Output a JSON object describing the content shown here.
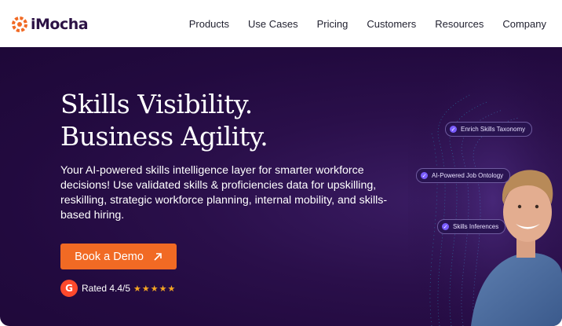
{
  "header": {
    "logo_text": "iMocha",
    "nav": [
      "Products",
      "Use Cases",
      "Pricing",
      "Customers",
      "Resources",
      "Company"
    ]
  },
  "hero": {
    "headline_line1": "Skills Visibility.",
    "headline_line2": "Business Agility.",
    "description": "Your AI-powered skills intelligence layer for smarter workforce decisions! Use validated skills & proficiencies data for upskilling, reskilling, strategic workforce planning, internal mobility, and skills-based hiring.",
    "cta_label": "Book a Demo",
    "rating_badge": "G",
    "rating_text": "Rated 4.4/5",
    "rating_stars": "★★★★★",
    "tags": [
      "Enrich Skills Taxonomy",
      "AI-Powered Job Ontology",
      "Skills Inferences"
    ]
  },
  "colors": {
    "accent": "#f16a24",
    "hero_bg": "#220a3f",
    "logo_dark": "#2c1245",
    "g2_red": "#ff492c",
    "star": "#f5a623"
  }
}
